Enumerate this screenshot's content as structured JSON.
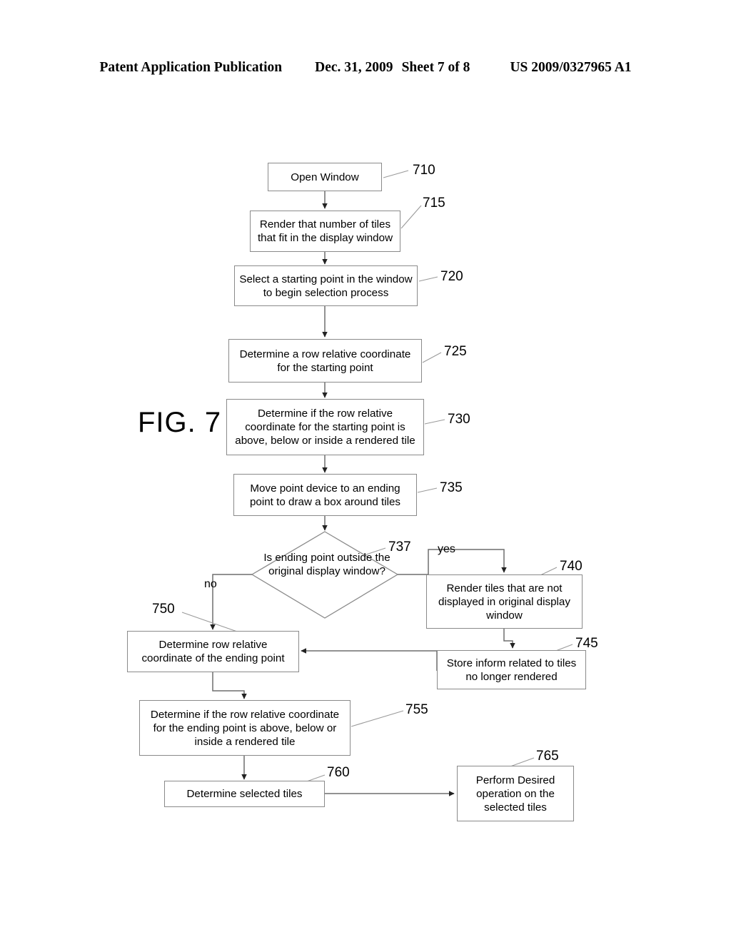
{
  "header": {
    "publication": "Patent Application Publication",
    "date": "Dec. 31, 2009",
    "sheet": "Sheet 7 of 8",
    "patent_number": "US 2009/0327965 A1"
  },
  "figure": {
    "label": "FIG. 7"
  },
  "flowchart": {
    "nodes": [
      {
        "ref": "710",
        "text": "Open Window",
        "shape": "process"
      },
      {
        "ref": "715",
        "text": "Render that number of tiles that fit in the display window",
        "shape": "process"
      },
      {
        "ref": "720",
        "text": "Select a starting point in the window to begin selection process",
        "shape": "process"
      },
      {
        "ref": "725",
        "text": "Determine a row relative coordinate for the starting point",
        "shape": "process"
      },
      {
        "ref": "730",
        "text": "Determine if the row relative coordinate for the starting point is above, below or inside a rendered tile",
        "shape": "process"
      },
      {
        "ref": "735",
        "text": "Move point device to an ending point to draw a box around tiles",
        "shape": "process"
      },
      {
        "ref": "737",
        "text": "Is ending point outside the original display window?",
        "shape": "decision"
      },
      {
        "ref": "740",
        "text": "Render tiles that are not displayed in original display window",
        "shape": "process"
      },
      {
        "ref": "745",
        "text": "Store inform related to tiles no longer rendered",
        "shape": "process"
      },
      {
        "ref": "750",
        "text": "Determine row relative coordinate of the ending point",
        "shape": "process"
      },
      {
        "ref": "755",
        "text": "Determine if the row relative coordinate for the ending point is above, below or inside a rendered tile",
        "shape": "process"
      },
      {
        "ref": "760",
        "text": "Determine selected tiles",
        "shape": "process"
      },
      {
        "ref": "765",
        "text": "Perform Desired operation on the selected tiles",
        "shape": "process"
      }
    ],
    "branch_labels": {
      "yes": "yes",
      "no": "no"
    },
    "line_color": "#6e6e6e"
  }
}
